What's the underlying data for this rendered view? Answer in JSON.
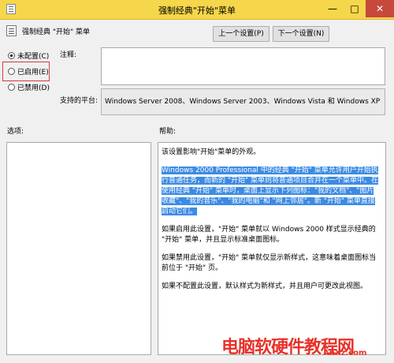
{
  "window": {
    "title": "强制经典\"开始\"菜单",
    "minimize": "—",
    "maximize": "□",
    "close": "✕"
  },
  "header": {
    "setting_name": "强制经典 \"开始\" 菜单",
    "prev_button": "上一个设置(P)",
    "next_button": "下一个设置(N)"
  },
  "state": {
    "not_configured": "未配置(C)",
    "enabled": "已启用(E)",
    "disabled": "已禁用(D)",
    "selected": "not_configured"
  },
  "comment": {
    "label": "注释:",
    "value": ""
  },
  "platform": {
    "label": "支持的平台:",
    "value": "Windows Server 2008、Windows Server 2003、Windows Vista 和 Windows XP"
  },
  "options": {
    "label": "选项:"
  },
  "help": {
    "label": "帮助:",
    "p1": "该设置影响\"开始\"菜单的外观。",
    "p2": "Windows 2000 Professional 中的经典 \"开始\" 菜单允许用户开始执行普通任务，而新的 \"开始\" 菜单则将普通项目合并在一个菜单中。在使用经典 \"开始\" 菜单时，桌面上显示下列图标：\"我的文档\"、\"图片收藏\"、\"我的音乐\"、\"我的电脑\"和 \"网上邻居\"。新 \"开始\" 菜单直接启动它们。",
    "p3": "如果启用此设置，\"开始\" 菜单就以 Windows 2000 样式显示经典的 \"开始\" 菜单，并且显示标准桌面图标。",
    "p4": "如果禁用此设置，\"开始\" 菜单就仅显示新样式，这意味着桌面图标当前位于 \"开始\" 页。",
    "p5": "如果不配置此设置，默认样式为新样式，并且用户可更改此视图。"
  },
  "watermark": {
    "text": "电脑软硬件教程网",
    "url": "AnXz.com"
  },
  "colors": {
    "titlebar": "#f6d64a",
    "selection": "#3c8be3",
    "highlight_box": "#d23b3b",
    "watermark": "#e8322a"
  }
}
